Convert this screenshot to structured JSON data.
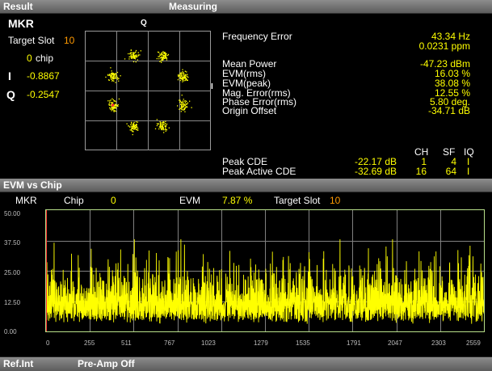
{
  "top_bar": {
    "result_label": "Result",
    "measuring_label": "Measuring"
  },
  "marker": {
    "title": "MKR",
    "target_slot_label": "Target Slot",
    "target_slot_value": "10",
    "chip_value": "0",
    "chip_label": "chip",
    "i_label": "I",
    "i_value": "-0.8867",
    "q_label": "Q",
    "q_value": "-0.2547"
  },
  "constellation": {
    "q_axis_label": "Q",
    "i_axis_label": "I"
  },
  "measurements": {
    "frequency_error": {
      "label": "Frequency Error",
      "value_hz": "43.34 Hz",
      "value_ppm": "0.0231 ppm"
    },
    "rows": [
      {
        "label": "Mean Power",
        "value": "-47.23 dBm"
      },
      {
        "label": "EVM(rms)",
        "value": "16.03 %"
      },
      {
        "label": "EVM(peak)",
        "value": "38.08 %"
      },
      {
        "label": "Mag. Error(rms)",
        "value": "12.55 %"
      },
      {
        "label": "Phase Error(rms)",
        "value": "5.80 deg."
      },
      {
        "label": "Origin Offset",
        "value": "-34.71 dB"
      }
    ]
  },
  "cde": {
    "headers": [
      "CH",
      "SF",
      "IQ"
    ],
    "rows": [
      {
        "label": "Peak CDE",
        "value": "-22.17 dB",
        "ch": "1",
        "sf": "4",
        "iq": "I"
      },
      {
        "label": "Peak Active CDE",
        "value": "-32.69 dB",
        "ch": "16",
        "sf": "64",
        "iq": "I"
      }
    ]
  },
  "evm_section": {
    "title": "EVM vs Chip",
    "mkr_label": "MKR",
    "chip_label": "Chip",
    "chip_value": "0",
    "evm_label": "EVM",
    "evm_value": "7.87 %",
    "target_slot_label": "Target Slot",
    "target_slot_value": "10"
  },
  "chart_data": {
    "type": "line",
    "title": "EVM vs Chip",
    "xlabel": "",
    "ylabel": "",
    "xlim": [
      0,
      2559
    ],
    "ylim": [
      0,
      50
    ],
    "x_ticks": [
      "0",
      "255",
      "511",
      "767",
      "1023",
      "1279",
      "1535",
      "1791",
      "2047",
      "2303",
      "2559"
    ],
    "y_ticks": [
      "50.00",
      "37.50",
      "25.00",
      "12.50",
      "0.00"
    ],
    "series": [
      {
        "color": "#ffff00",
        "num_points": 2560,
        "typical_range": [
          3,
          25
        ],
        "peak": 38
      }
    ],
    "marker": {
      "chip": 0,
      "evm": 7.87
    },
    "grid": true
  },
  "bottom_bar": {
    "ref_label": "Ref.Int",
    "preamp_label": "Pre-Amp Off"
  },
  "colors": {
    "trace": "#ffff00",
    "accent": "#ff9900",
    "frame": "#b8e08a",
    "grid": "#808080"
  }
}
